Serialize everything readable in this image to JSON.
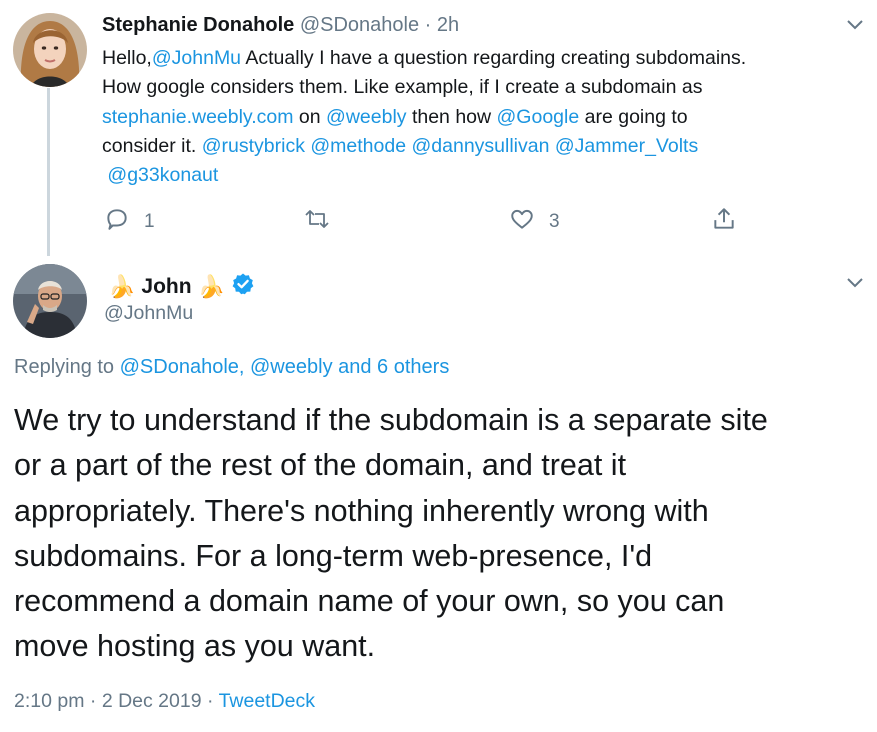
{
  "colors": {
    "accent": "#1b95e0",
    "muted": "#657786",
    "text": "#14171a",
    "verified": "#1da1f2"
  },
  "tweet1": {
    "name": "Stephanie Donahole",
    "handle": "@SDonahole",
    "sep": "·",
    "time": "2h",
    "body_lines": [
      [
        {
          "t": "Hello,"
        },
        {
          "t": "@JohnMu",
          "link": true
        },
        {
          "t": " Actually I have a question regarding creating subdomains."
        }
      ],
      [
        {
          "t": "How google considers them. Like example, if I create a subdomain as"
        }
      ],
      [
        {
          "t": "stephanie.weebly.com",
          "link": true
        },
        {
          "t": " on "
        },
        {
          "t": "@weebly",
          "link": true
        },
        {
          "t": " then how "
        },
        {
          "t": "@Google",
          "link": true
        },
        {
          "t": " are going to"
        }
      ],
      [
        {
          "t": "consider it. "
        },
        {
          "t": "@rustybrick",
          "link": true
        },
        {
          "t": " "
        },
        {
          "t": "@methode",
          "link": true
        },
        {
          "t": " "
        },
        {
          "t": "@dannysullivan",
          "link": true
        },
        {
          "t": " "
        },
        {
          "t": "@Jammer_Volts",
          "link": true
        }
      ],
      [
        {
          "t": " "
        },
        {
          "t": "@g33konaut",
          "link": true
        }
      ]
    ],
    "actions": {
      "reply_count": "1",
      "retweet_count": "",
      "like_count": "3"
    }
  },
  "tweet2": {
    "name": "John",
    "handle": "@JohnMu",
    "replying_prefix": "Replying to ",
    "replying_links": "@SDonahole, @weebly and 6 others",
    "body_lines": [
      "We try to understand if the subdomain is a separate site",
      "or a part of the rest of the domain, and treat it",
      "appropriately. There's nothing inherently wrong with",
      "subdomains. For a long-term web-presence, I'd",
      "recommend a domain name of your own, so you can",
      "move hosting as you want."
    ],
    "time": "2:10 pm",
    "date": "2 Dec 2019",
    "sep": "·",
    "source": "TweetDeck"
  }
}
